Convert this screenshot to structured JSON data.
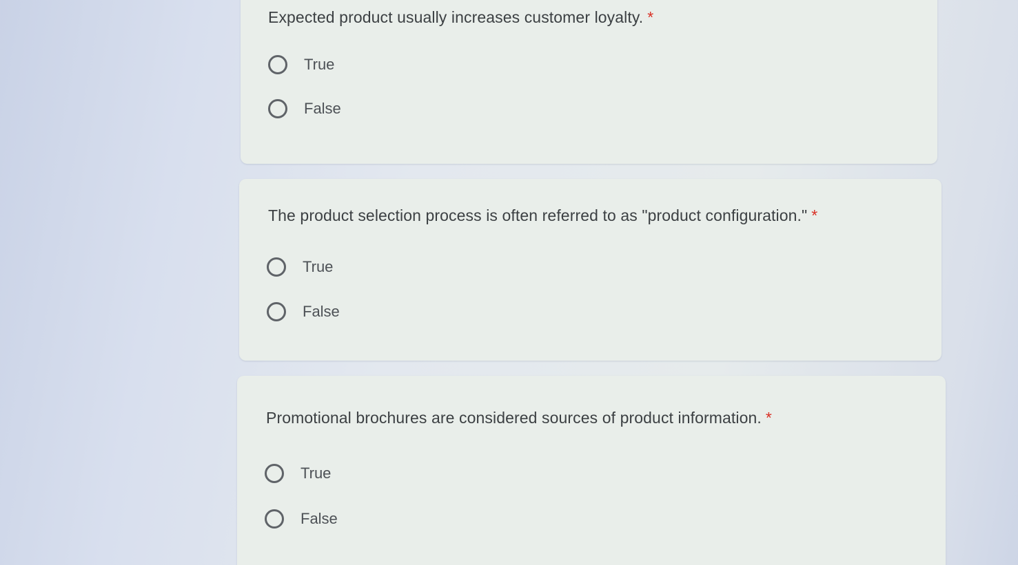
{
  "questions": [
    {
      "text": "Expected product usually increases customer loyalty.",
      "required_mark": "*",
      "options": [
        {
          "label": "True",
          "selected": false
        },
        {
          "label": "False",
          "selected": false
        }
      ]
    },
    {
      "text": "The product selection process is often referred to as \"product configuration.\"",
      "required_mark": "*",
      "options": [
        {
          "label": "True",
          "selected": false
        },
        {
          "label": "False",
          "selected": false
        }
      ]
    },
    {
      "text": "Promotional brochures are considered sources of product information.",
      "required_mark": "*",
      "options": [
        {
          "label": "True",
          "selected": false
        },
        {
          "label": "False",
          "selected": false
        }
      ]
    }
  ],
  "colors": {
    "required_mark": "#d93025",
    "radio_border": "#5f6368",
    "card_background": "#e9eeea"
  }
}
